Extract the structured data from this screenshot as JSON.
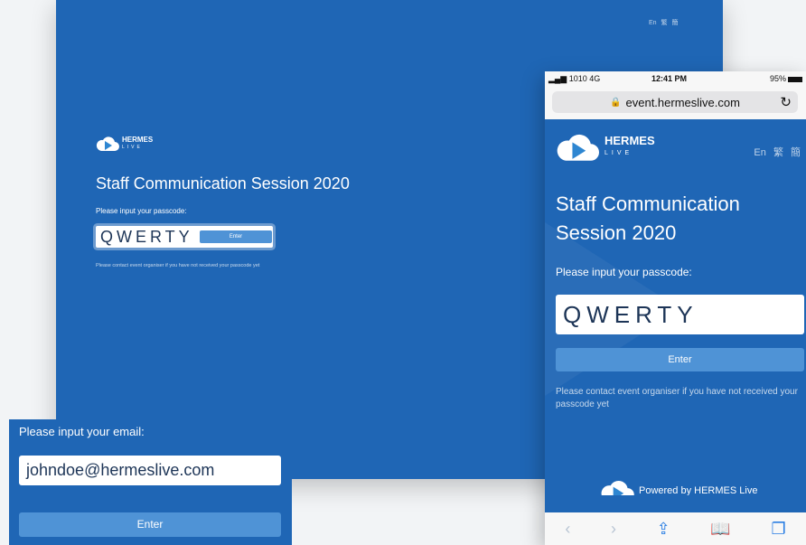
{
  "desktop": {
    "languages": [
      "En",
      "繁",
      "簡"
    ],
    "brand": "HERMES",
    "brand_sub": "LIVE",
    "title": "Staff Communication Session 2020",
    "prompt": "Please input your passcode:",
    "passcode_value": "QWERTY",
    "enter_label": "Enter",
    "note": "Please contact event organiser if you have not received your passcode yet"
  },
  "email_card": {
    "label": "Please input your email:",
    "email_value": "johndoe@hermeslive.com",
    "enter_label": "Enter"
  },
  "mobile": {
    "status": {
      "carrier": "1010  4G",
      "time": "12:41 PM",
      "battery": "95%"
    },
    "url": "event.hermeslive.com",
    "brand": "HERMES",
    "brand_sub": "LIVE",
    "languages": [
      "En",
      "繁",
      "簡"
    ],
    "title": "Staff Communication Session 2020",
    "prompt": "Please input your passcode:",
    "passcode_value": "QWERTY",
    "enter_label": "Enter",
    "note": "Please contact event organiser if you have not received your passcode yet",
    "powered": "Powered by HERMES Live",
    "toolbar_icons": [
      "back-icon",
      "forward-icon",
      "share-icon",
      "bookmarks-icon",
      "tabs-icon"
    ]
  },
  "colors": {
    "brand_blue": "#1f66b5",
    "button_blue": "#4f93d6",
    "ios_blue": "#2a7ee3"
  }
}
